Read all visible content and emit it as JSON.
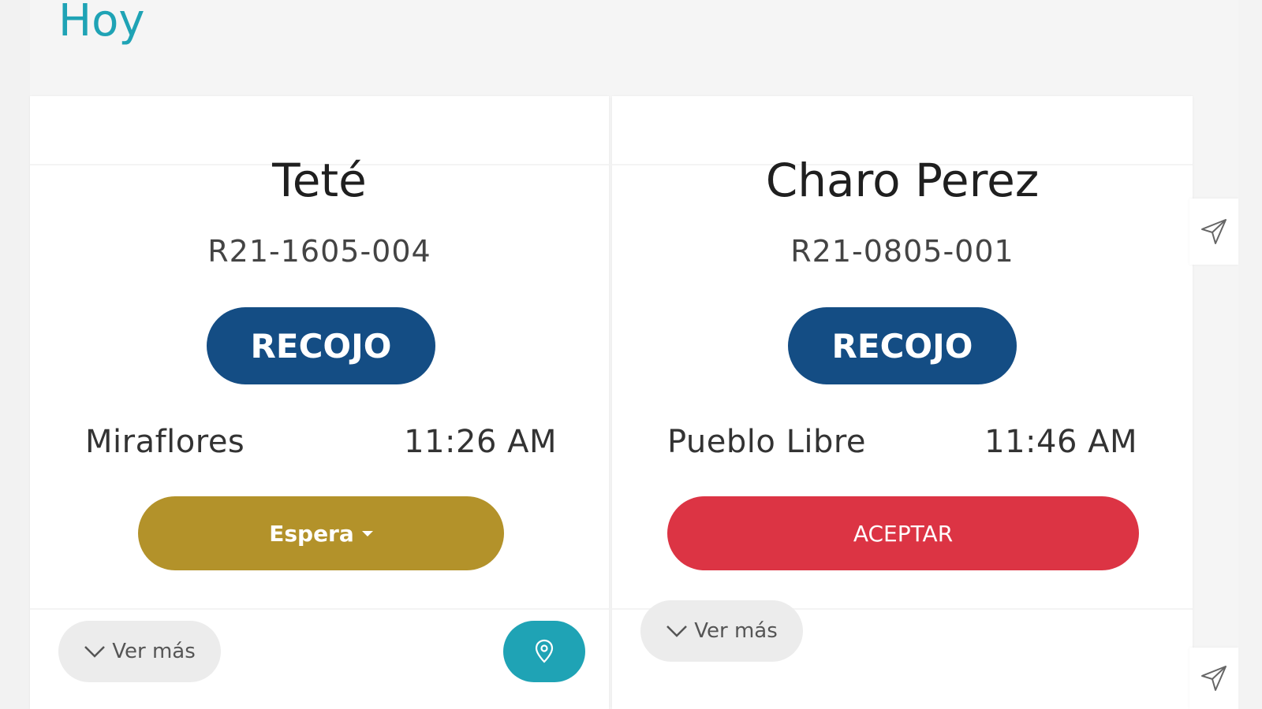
{
  "page": {
    "heading": "Hoy"
  },
  "orders": [
    {
      "client": "Teté",
      "code": "R21-1605-004",
      "type": "RECOJO",
      "district": "Miraflores",
      "time": "11:26 AM",
      "status_button": "Espera",
      "more_label": "Ver más"
    },
    {
      "client": "Charo Perez",
      "code": "R21-0805-001",
      "type": "RECOJO",
      "district": "Pueblo Libre",
      "time": "11:46 AM",
      "action_button": "ACEPTAR",
      "more_label": "Ver más"
    }
  ],
  "icons": {
    "send": "send-icon",
    "location": "map-pin-icon",
    "chevron": "chevron-down-icon"
  },
  "colors": {
    "heading": "#1fa3b5",
    "type_pill": "#144d84",
    "wait_button": "#b3922a",
    "accept_button": "#dc3444",
    "location_button": "#1fa3b5"
  }
}
